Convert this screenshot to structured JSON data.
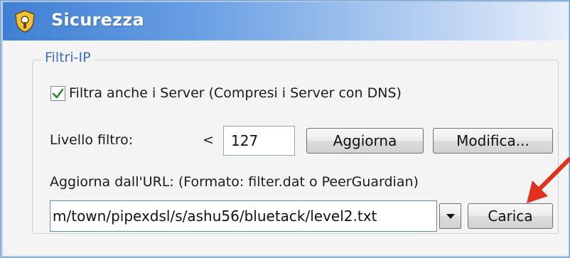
{
  "window": {
    "title": "Sicurezza",
    "icon": "security-shield-icon"
  },
  "group": {
    "legend": "Filtri-IP"
  },
  "checkbox": {
    "label": "Filtra anche i Server (Compresi i Server con DNS)",
    "checked": true
  },
  "filter_level": {
    "label": "Livello filtro:",
    "comparator": "<",
    "value": "127"
  },
  "buttons": {
    "update": "Aggiorna",
    "edit": "Modifica...",
    "load": "Carica"
  },
  "url": {
    "label": "Aggiorna dall'URL: (Formato: filter.dat o PeerGuardian)",
    "value": "m/town/pipexdsl/s/ashu56/bluetack/level2.txt"
  },
  "colors": {
    "annotation_arrow": "#e0301e",
    "title_gradient_start": "#3f7fd4",
    "legend_text": "#3d6ec2"
  }
}
